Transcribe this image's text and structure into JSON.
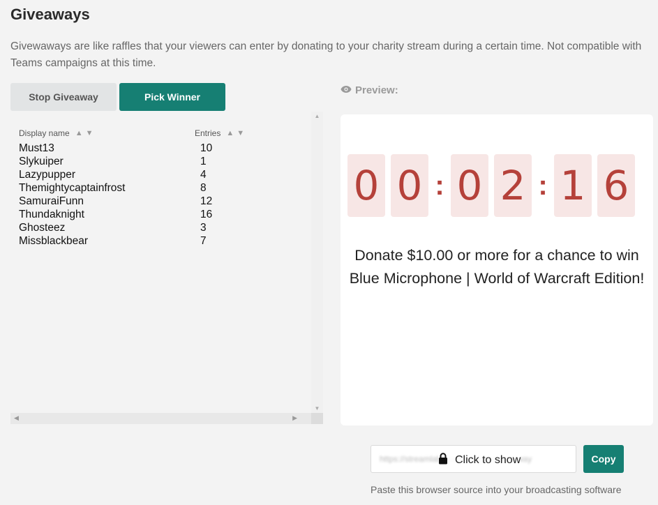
{
  "page": {
    "title": "Giveaways",
    "description": "Givewaways are like raffles that your viewers can enter by donating to your charity stream during a certain time. Not compatible with Teams campaigns at this time."
  },
  "actions": {
    "stop_label": "Stop Giveaway",
    "pick_label": "Pick Winner"
  },
  "table": {
    "columns": [
      "Display name",
      "Entries"
    ],
    "sort_icons": "▲▼",
    "rows": [
      {
        "name": "Must13",
        "entries": "10"
      },
      {
        "name": "Slykuiper",
        "entries": "1"
      },
      {
        "name": "Lazypupper",
        "entries": "4"
      },
      {
        "name": "Themightycaptainfrost",
        "entries": "8"
      },
      {
        "name": "SamuraiFunn",
        "entries": "12"
      },
      {
        "name": "Thundaknight",
        "entries": "16"
      },
      {
        "name": "Ghosteez",
        "entries": "3"
      },
      {
        "name": "Missblackbear",
        "entries": "7"
      }
    ]
  },
  "preview": {
    "label": "Preview:",
    "countdown": [
      "0",
      "0",
      ":",
      "0",
      "2",
      ":",
      "1",
      "6"
    ],
    "message": "Donate $10.00 or more for a chance to win Blue Microphone | World of Warcraft Edition!"
  },
  "source": {
    "blurred_url": "https://streamlabs.com/widgets/giveaway",
    "click_to_show": "Click to show",
    "copy_label": "Copy",
    "hint": "Paste this browser source into your broadcasting software"
  },
  "colors": {
    "accent": "#167f73",
    "digit_bg": "#f7e6e5",
    "digit_fg": "#b5413a"
  }
}
